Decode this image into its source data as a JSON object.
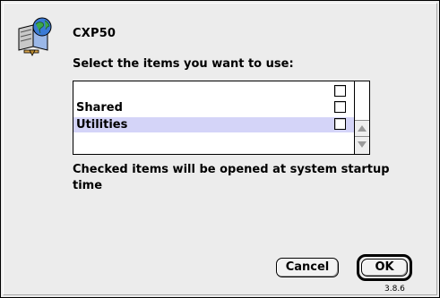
{
  "dialog": {
    "title": "CXP50",
    "icon": "app-globe-folder-icon",
    "instruction": "Select the items you want to use:",
    "note": "Checked items will be opened at system startup time",
    "version": "3.8.6"
  },
  "list": {
    "items": [
      {
        "label": "",
        "checked": false,
        "selected": false
      },
      {
        "label": "Shared",
        "checked": false,
        "selected": false
      },
      {
        "label": "Utilities",
        "checked": false,
        "selected": true
      }
    ]
  },
  "buttons": {
    "cancel_label": "Cancel",
    "ok_label": "OK"
  },
  "colors": {
    "selection": "#d4d4f8",
    "dialog_bg": "#ececec"
  }
}
